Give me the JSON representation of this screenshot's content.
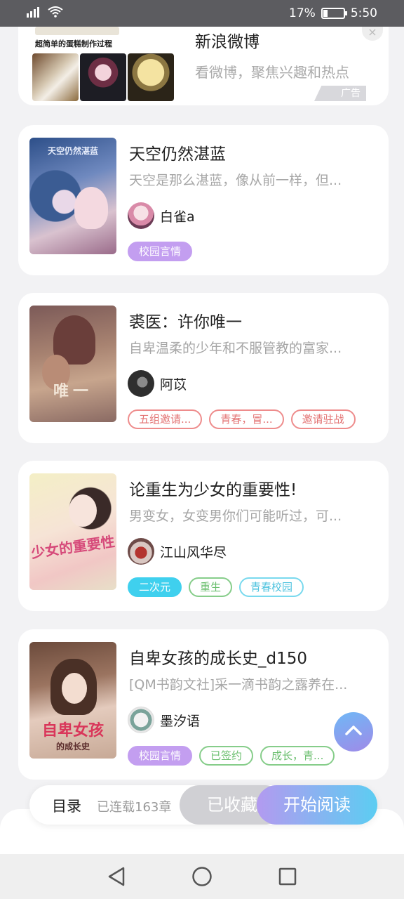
{
  "status_bar": {
    "battery": "17%",
    "time": "5:50",
    "icons": [
      "signal-icon",
      "wifi-icon",
      "battery-icon"
    ]
  },
  "ad": {
    "thumb_caption": "超简单的蛋糕制作过程",
    "title": "新浪微博",
    "description": "看微博，聚焦兴趣和热点",
    "badge": "广告",
    "close": "×"
  },
  "books": [
    {
      "title": "天空仍然湛蓝",
      "cover_text": "天空仍然湛蓝",
      "description": "天空是那么湛蓝，像从前一样，但...",
      "author": "白雀a",
      "tags": [
        {
          "label": "校园言情",
          "style": "fill-purple"
        }
      ]
    },
    {
      "title": "裘医：许你唯一",
      "cover_text": "唯一",
      "description": "自卑温柔的少年和不服管教的富家...",
      "author": "阿苡",
      "tags": [
        {
          "label": "五组邀请...",
          "style": "red"
        },
        {
          "label": "青春，冒...",
          "style": "red"
        },
        {
          "label": "邀请驻战",
          "style": "red"
        }
      ]
    },
    {
      "title": "论重生为少女的重要性!",
      "cover_text": "少女的重要性",
      "description": "男变女，女变男你们可能听过，可...",
      "author": "江山风华尽",
      "tags": [
        {
          "label": "二次元",
          "style": "fill-cyan"
        },
        {
          "label": "重生",
          "style": "green"
        },
        {
          "label": "青春校园",
          "style": "cyan"
        }
      ]
    },
    {
      "title": "自卑女孩的成长史_d150",
      "cover_text": "自卑女孩",
      "cover_sub": "的成长史",
      "description": "[QM书韵文社]采一滴书韵之露养在...",
      "author": "墨汐语",
      "tags": [
        {
          "label": "校园言情",
          "style": "fill-purple"
        },
        {
          "label": "已签约",
          "style": "green"
        },
        {
          "label": "成长，青...",
          "style": "green"
        }
      ]
    }
  ],
  "action_bar": {
    "toc": "目录",
    "chapters": "已连载163章",
    "collected": "已收藏",
    "start_reading": "开始阅读"
  },
  "nav_bar": {
    "back": "back-icon",
    "home": "home-icon",
    "recents": "recents-icon"
  },
  "colors": {
    "accent_purple": "#c39ef0",
    "accent_cyan": "#3fd0ee",
    "tag_red": "#ee8c8c",
    "tag_green": "#86cd8a"
  }
}
